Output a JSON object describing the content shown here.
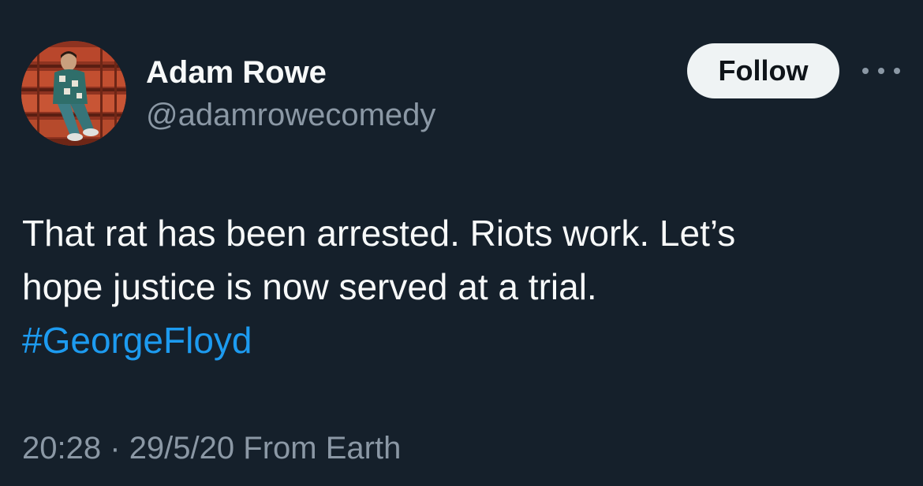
{
  "author": {
    "display_name": "Adam Rowe",
    "handle": "@adamrowecomedy",
    "avatar_alt": "avatar"
  },
  "actions": {
    "follow_label": "Follow",
    "more_icon": "more-horizontal-icon"
  },
  "tweet": {
    "line_1": "That rat has been arrested. Riots work. Let’s",
    "line_2": "hope justice is now served at a trial.",
    "hashtag": "#GeorgeFloyd"
  },
  "meta": {
    "time": "20:28",
    "separator": "·",
    "date": "29/5/20",
    "source": "From Earth"
  },
  "colors": {
    "background": "#15202b",
    "primary_text": "#f7f9f9",
    "secondary_text": "#8b98a5",
    "link": "#1d9bf0",
    "follow_bg": "#eff3f4"
  }
}
